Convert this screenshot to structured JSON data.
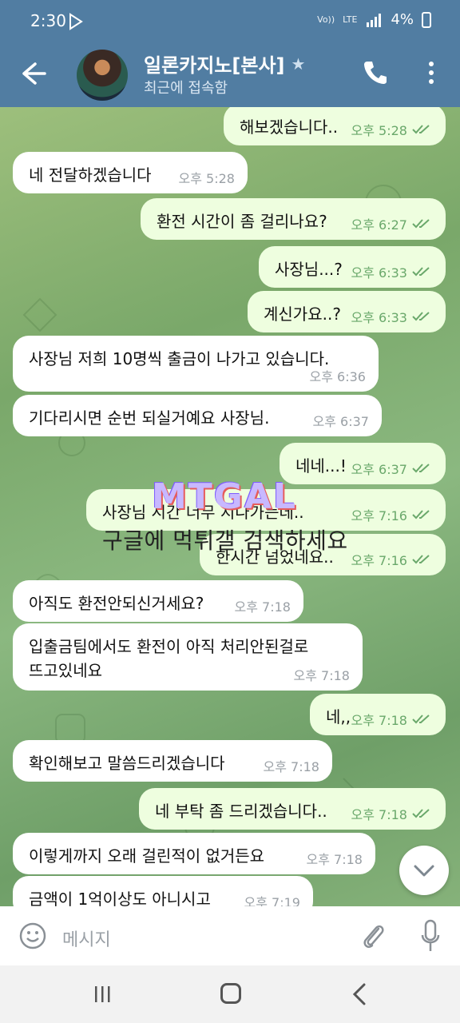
{
  "status_bar": {
    "time": "2:30",
    "carrier": "Vo))",
    "network": "LTE",
    "battery": "4%"
  },
  "header": {
    "title": "일론카지노[본사]",
    "subtitle": "최근에 접속함"
  },
  "messages": [
    {
      "dir": "out",
      "text": "해보겠습니다..",
      "time": "오후 5:28"
    },
    {
      "dir": "in",
      "text": "네 전달하겠습니다",
      "time": "오후 5:28"
    },
    {
      "dir": "out",
      "text": "환전 시간이 좀 걸리나요?",
      "time": "오후 6:27"
    },
    {
      "dir": "out",
      "text": "사장님...?",
      "time": "오후 6:33"
    },
    {
      "dir": "out",
      "text": "계신가요..?",
      "time": "오후 6:33"
    },
    {
      "dir": "in",
      "text": "사장님 저희 10명씩 출금이 나가고 있습니다.",
      "time": "오후 6:36"
    },
    {
      "dir": "in",
      "text": "기다리시면 순번 되실거예요 사장님.",
      "time": "오후 6:37"
    },
    {
      "dir": "out",
      "text": "네네...!",
      "time": "오후 6:37"
    },
    {
      "dir": "out",
      "text": "사장님 시간 너무 지나가는데..",
      "time": "오후 7:16"
    },
    {
      "dir": "out",
      "text": "한시간 넘었네요..",
      "time": "오후 7:16"
    },
    {
      "dir": "in",
      "text": "아직도 환전안되신거세요?",
      "time": "오후 7:18"
    },
    {
      "dir": "in",
      "text": "입출금팀에서도 환전이 아직 처리안된걸로\n뜨고있네요",
      "time": "오후 7:18"
    },
    {
      "dir": "out",
      "text": "네,,",
      "time": "오후 7:18"
    },
    {
      "dir": "in",
      "text": "확인해보고 말씀드리겠습니다",
      "time": "오후 7:18"
    },
    {
      "dir": "out",
      "text": "네 부탁 좀 드리겠습니다..",
      "time": "오후 7:18"
    },
    {
      "dir": "in",
      "text": "이렇게까지 오래 걸린적이 없거든요",
      "time": "오후 7:18"
    },
    {
      "dir": "in",
      "text": "금액이 1억이상도 아니시고",
      "time": "오후 7:19"
    }
  ],
  "watermark": {
    "logo": "MTGAL",
    "text": "구글에 먹튀갤 검색하세요"
  },
  "composer": {
    "placeholder": "메시지"
  },
  "colors": {
    "header": "#517da2",
    "bubble_in": "#ffffff",
    "bubble_out": "#eefedf",
    "check": "#6aa86b"
  }
}
